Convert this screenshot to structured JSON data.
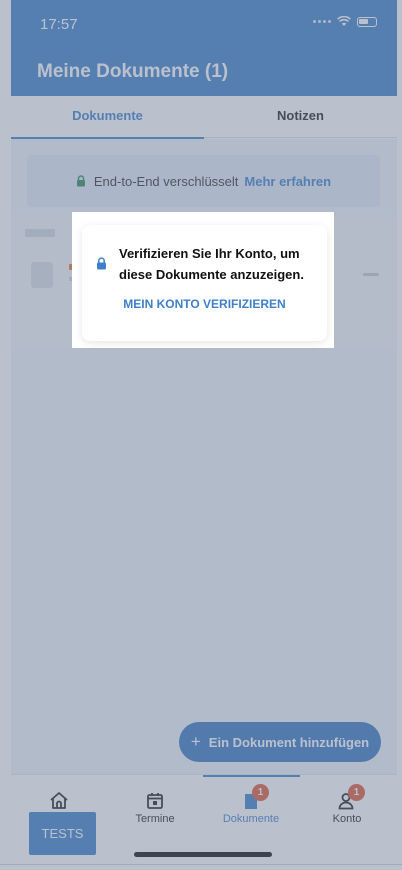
{
  "status_bar": {
    "time": "17:57"
  },
  "header": {
    "title": "Meine Dokumente (1)"
  },
  "tabs": [
    {
      "label": "Dokumente",
      "active": true
    },
    {
      "label": "Notizen",
      "active": false
    }
  ],
  "e2e_banner": {
    "text": "End-to-End verschlüsselt",
    "link": "Mehr erfahren"
  },
  "modal": {
    "message": "Verifizieren Sie Ihr Konto, um diese Dokumente anzuzeigen.",
    "action": "MEIN KONTO VERIFIZIEREN",
    "icon": "lock-icon"
  },
  "fab": {
    "icon": "+",
    "label": "Ein Dokument hinzufügen"
  },
  "bottom_nav": [
    {
      "label": "",
      "icon": "home-icon",
      "badge": null,
      "active": false
    },
    {
      "label": "Termine",
      "icon": "calendar-icon",
      "badge": null,
      "active": false
    },
    {
      "label": "Dokumente",
      "icon": "document-icon",
      "badge": "1",
      "active": true
    },
    {
      "label": "Konto",
      "icon": "account-icon",
      "badge": "1",
      "active": false
    }
  ],
  "tests_button": {
    "label": "TESTS"
  },
  "colors": {
    "primary": "#3f7fca",
    "badge": "#e05a3a",
    "secure_lock": "#2e8b57"
  }
}
